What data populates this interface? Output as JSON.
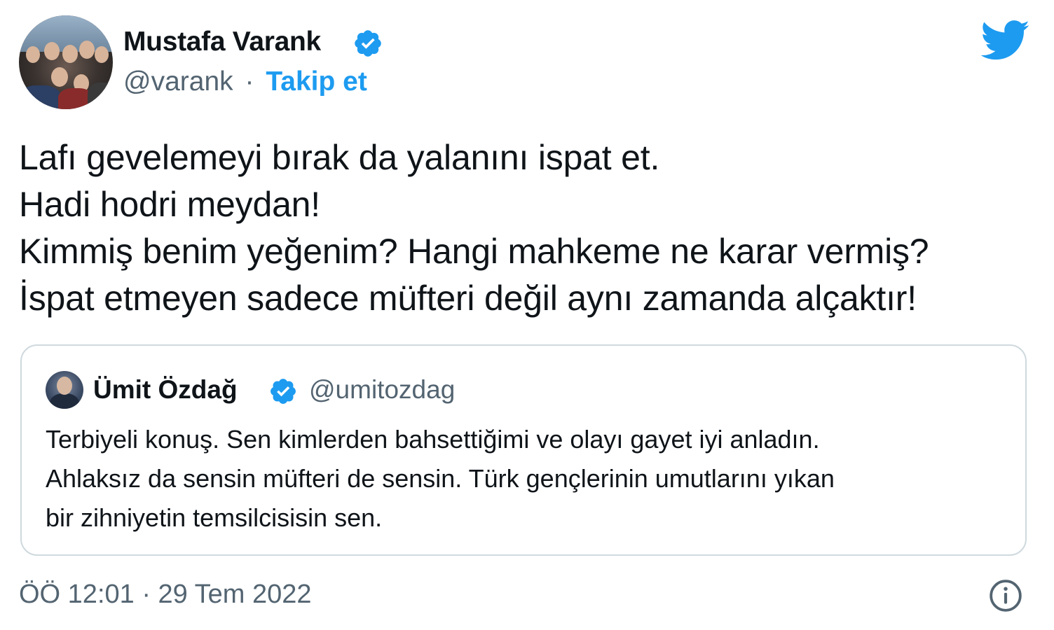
{
  "author": {
    "name": "Mustafa Varank",
    "handle": "@varank",
    "separator": "·",
    "follow_label": "Takip et",
    "verified": true,
    "avatar": "group-photo-avatar"
  },
  "brand": {
    "icon": "twitter-bird-icon",
    "color": "#1d9bf0"
  },
  "tweet": {
    "lines": [
      "Lafı gevelemeyi bırak da yalanını ispat et.",
      "Hadi hodri meydan!",
      "Kimmiş benim yeğenim? Hangi mahkeme ne karar vermiş?",
      "İspat etmeyen sadece müfteri değil aynı zamanda alçaktır!"
    ]
  },
  "quoted": {
    "name": "Ümit Özdağ",
    "handle": "@umitozdag",
    "verified": true,
    "lines": [
      "Terbiyeli konuş. Sen kimlerden bahsettiğimi ve olayı gayet iyi anladın.",
      "Ahlaksız da sensin müfteri de sensin. Türk gençlerinin umutlarını yıkan",
      "bir zihniyetin temsilcisisin sen."
    ]
  },
  "footer": {
    "timestamp": "ÖÖ 12:01 · 29 Tem 2022",
    "info_icon": "info-icon"
  },
  "colors": {
    "text": "#0f1419",
    "secondary": "#536471",
    "accent": "#1d9bf0",
    "border": "#cfd9de"
  }
}
